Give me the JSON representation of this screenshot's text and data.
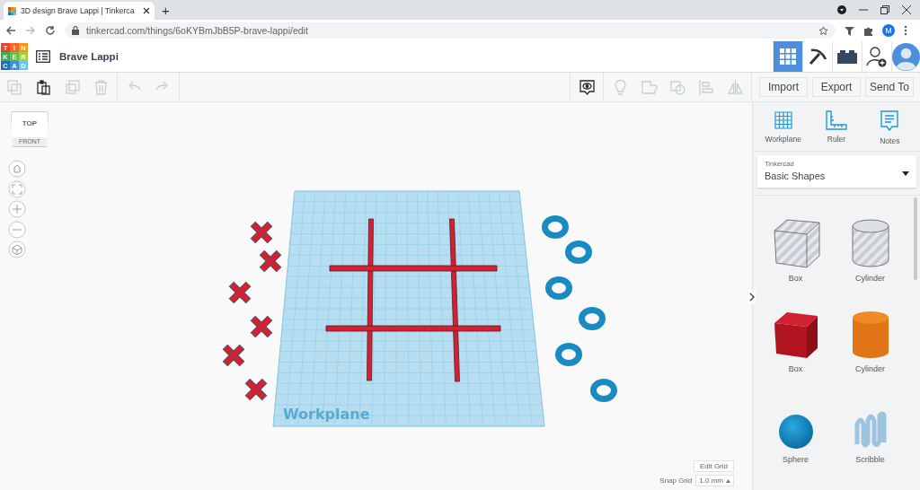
{
  "browser": {
    "tab_title": "3D design Brave Lappi | Tinkerca",
    "new_tab": "+",
    "url": "tinkercad.com/things/6oKYBmJbB5P-brave-lappi/edit",
    "profile_initial": "M"
  },
  "header": {
    "logo_letters": [
      "T",
      "I",
      "N",
      "K",
      "E",
      "R",
      "C",
      "A",
      "D"
    ],
    "design_title": "Brave Lappi",
    "view_modes": [
      {
        "kind": "grid",
        "selected": true
      },
      {
        "kind": "pickaxe",
        "selected": false
      },
      {
        "kind": "bricks",
        "selected": false
      }
    ]
  },
  "toolbar": {
    "edit_tools": [
      {
        "kind": "copy",
        "disabled": true
      },
      {
        "kind": "paste",
        "disabled": false
      },
      {
        "kind": "duplicate",
        "disabled": true
      },
      {
        "kind": "delete",
        "disabled": true
      },
      {
        "kind": "undo",
        "disabled": true
      },
      {
        "kind": "redo",
        "disabled": true
      }
    ],
    "shape_tools": [
      {
        "kind": "notes-toggle",
        "disabled": false
      },
      {
        "kind": "bulb",
        "disabled": true
      },
      {
        "kind": "group",
        "disabled": true
      },
      {
        "kind": "ungroup",
        "disabled": true
      },
      {
        "kind": "align",
        "disabled": true
      },
      {
        "kind": "mirror",
        "disabled": true
      }
    ],
    "actions": [
      "Import",
      "Export",
      "Send To"
    ]
  },
  "canvas": {
    "view_cube": {
      "top": "TOP",
      "front": "FRONT"
    },
    "workplane_label": "Workplane",
    "edit_grid": "Edit Grid",
    "snap_grid": {
      "label": "Snap Grid",
      "value": "1.0 mm"
    }
  },
  "panel": {
    "tools": [
      {
        "kind": "workplane",
        "label": "Workplane"
      },
      {
        "kind": "ruler",
        "label": "Ruler"
      },
      {
        "kind": "notes",
        "label": "Notes"
      }
    ],
    "library": {
      "label": "Tinkercad",
      "value": "Basic Shapes"
    },
    "shapes": [
      {
        "kind": "box-hole",
        "label": "Box"
      },
      {
        "kind": "cylinder-hole",
        "label": "Cylinder"
      },
      {
        "kind": "box",
        "label": "Box"
      },
      {
        "kind": "cylinder",
        "label": "Cylinder"
      },
      {
        "kind": "sphere",
        "label": "Sphere"
      },
      {
        "kind": "scribble",
        "label": "Scribble"
      }
    ]
  }
}
